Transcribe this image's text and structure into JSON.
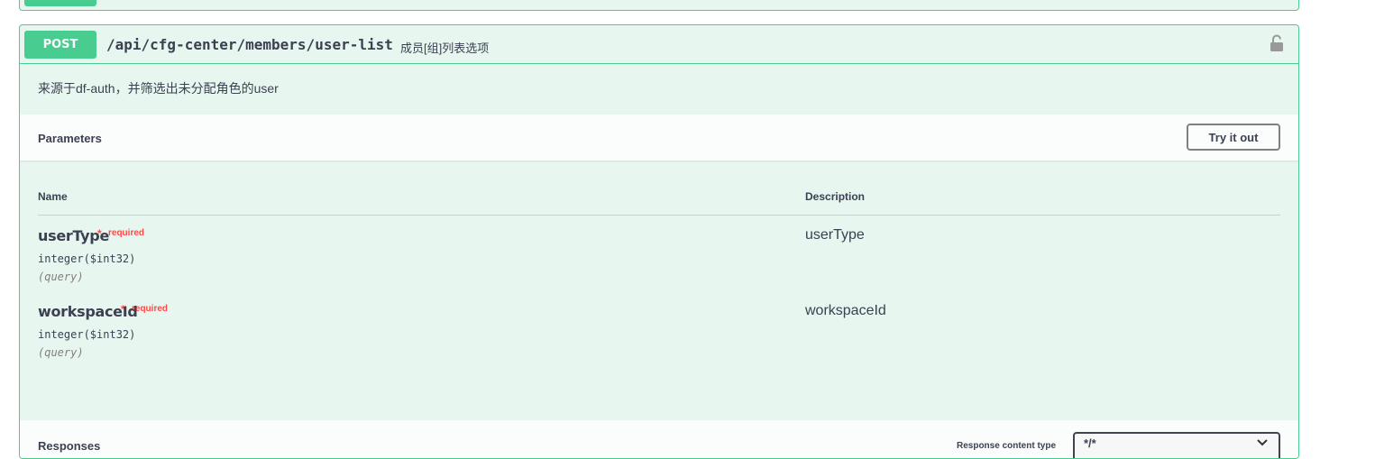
{
  "operation": {
    "method": "POST",
    "path": "/api/cfg-center/members/user-list",
    "summary": "成员[组]列表选项",
    "description": "来源于df-auth，并筛选出未分配角色的user"
  },
  "parameters": {
    "title": "Parameters",
    "try_button": "Try it out",
    "col_name": "Name",
    "col_description": "Description",
    "items": [
      {
        "name": "userType",
        "required_star": "*",
        "required_label": "required",
        "type": "integer($int32)",
        "in": "(query)",
        "description": "userType"
      },
      {
        "name": "workspaceId",
        "required_star": "*",
        "required_label": "required",
        "type": "integer($int32)",
        "in": "(query)",
        "description": "workspaceId"
      }
    ]
  },
  "responses": {
    "title": "Responses",
    "content_type_label": "Response content type",
    "content_type_value": "*/*"
  },
  "colors": {
    "post_green": "#49cc90",
    "block_bg": "#e8f6f0",
    "required_red": "#ff0000"
  },
  "icons": {
    "lock": "lock-icon",
    "select_caret": "chevron-down-icon"
  }
}
